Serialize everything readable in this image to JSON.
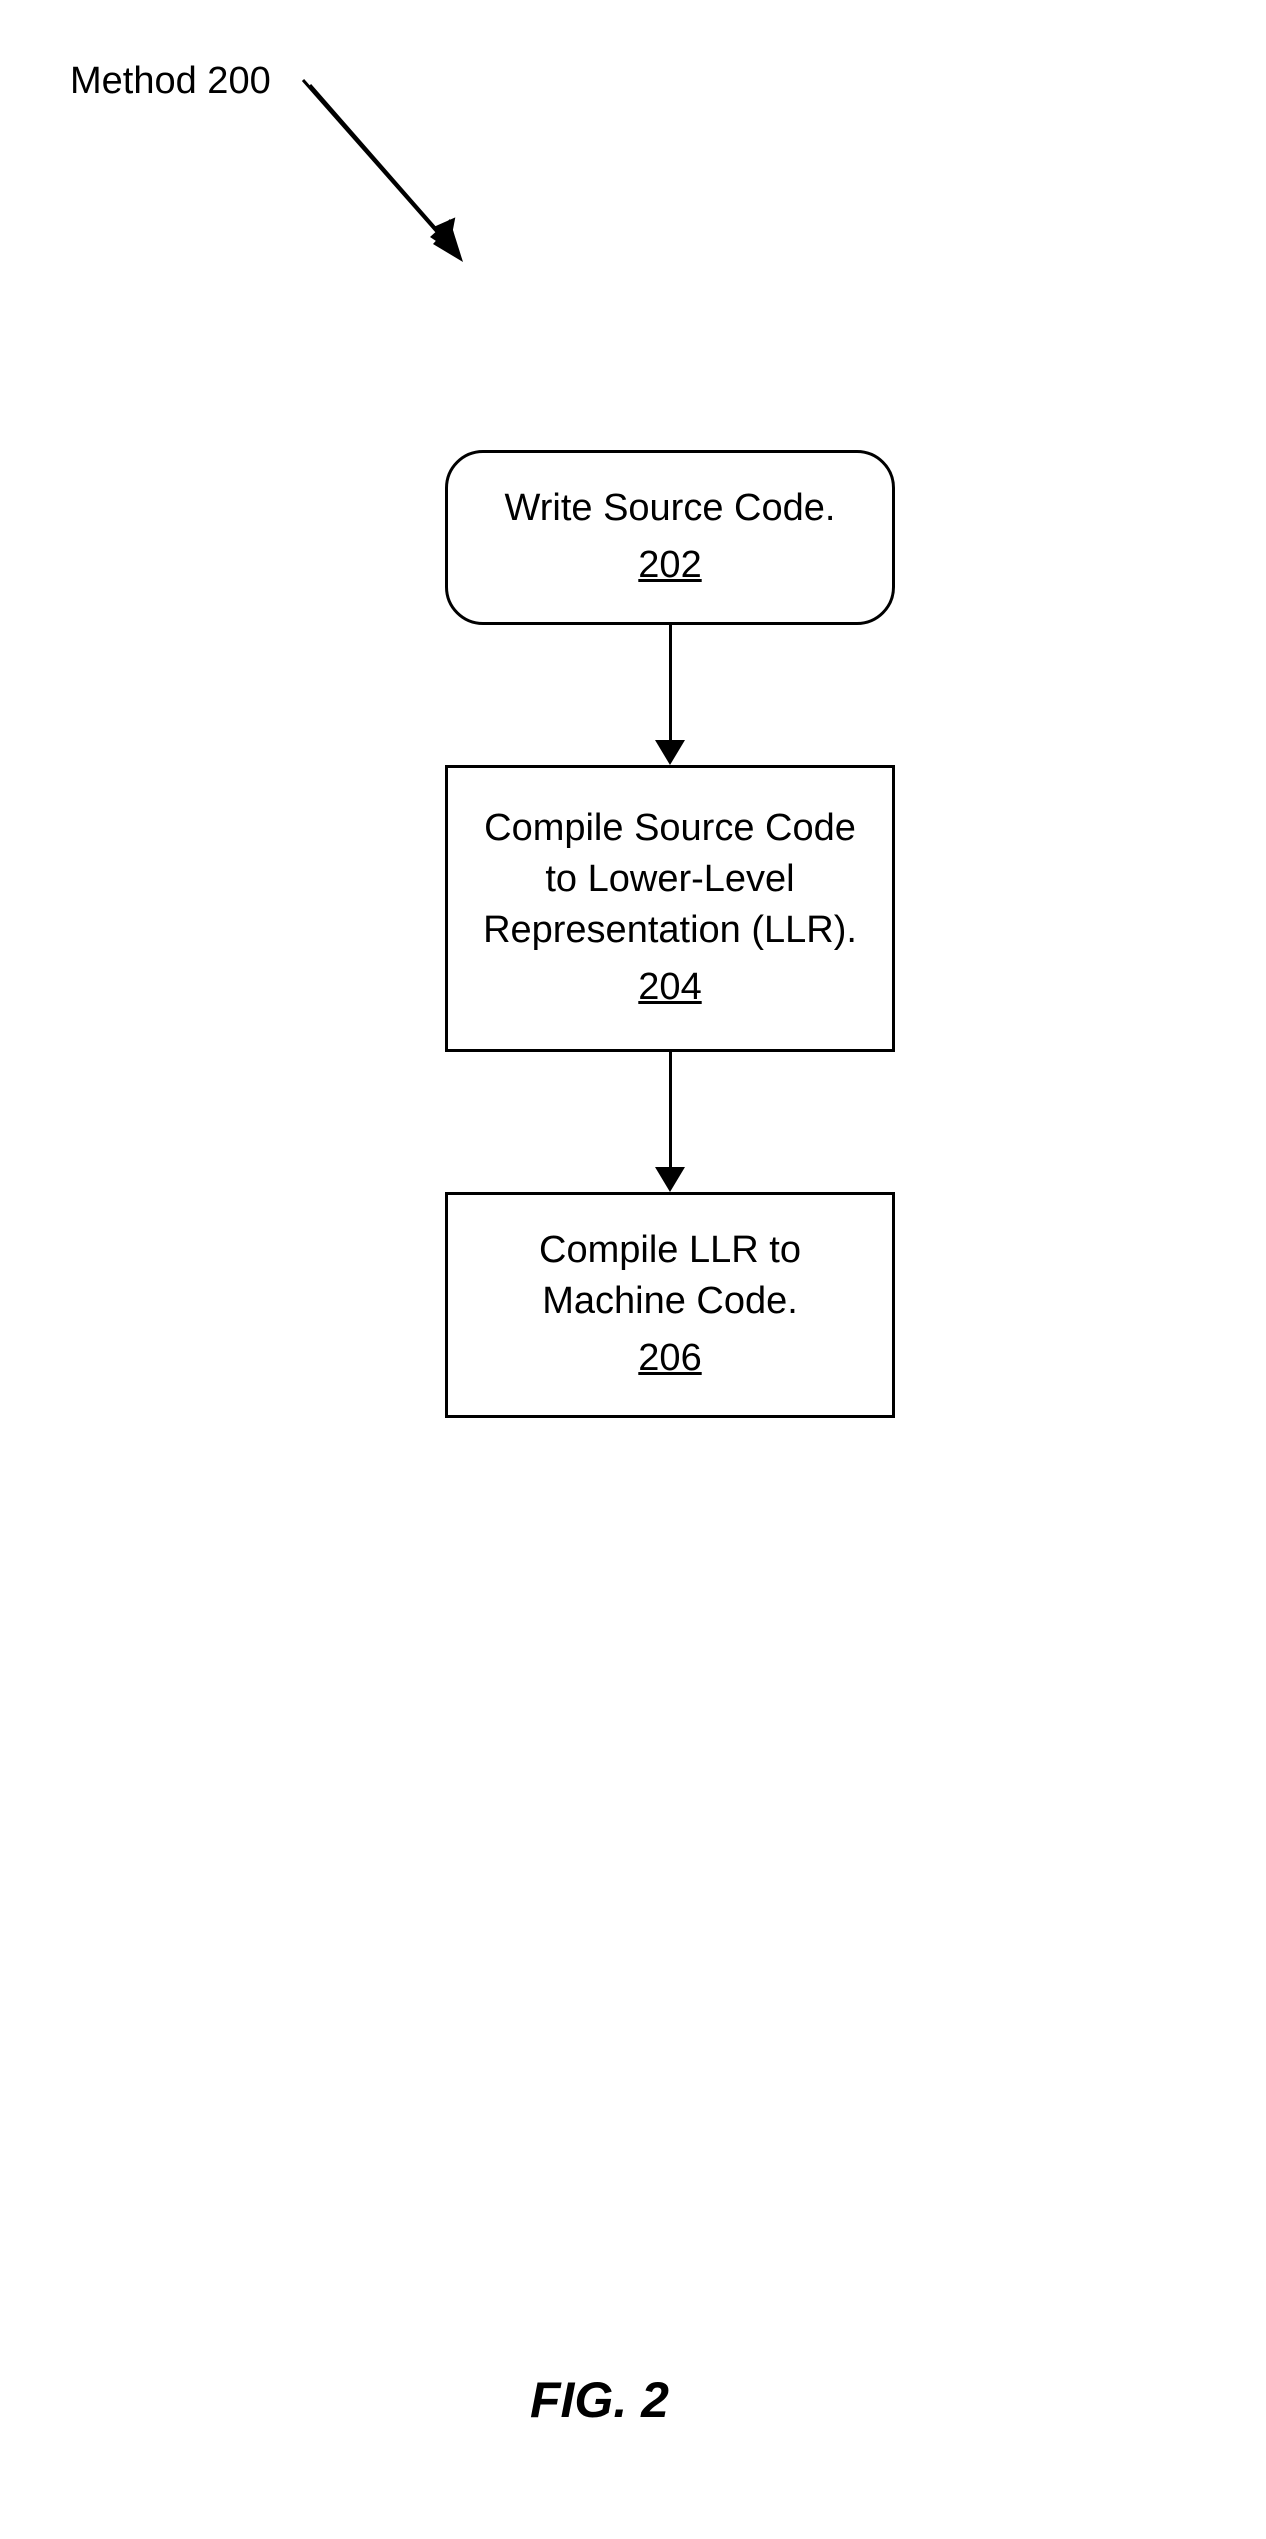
{
  "methodLabel": "Method 200",
  "figureLabel": "FIG. 2",
  "boxes": {
    "step1": {
      "text": "Write Source Code.",
      "ref": "202"
    },
    "step2": {
      "text": "Compile Source Code to Lower-Level Representation (LLR).",
      "ref": "204"
    },
    "step3": {
      "text": "Compile LLR to Machine Code.",
      "ref": "206"
    }
  }
}
